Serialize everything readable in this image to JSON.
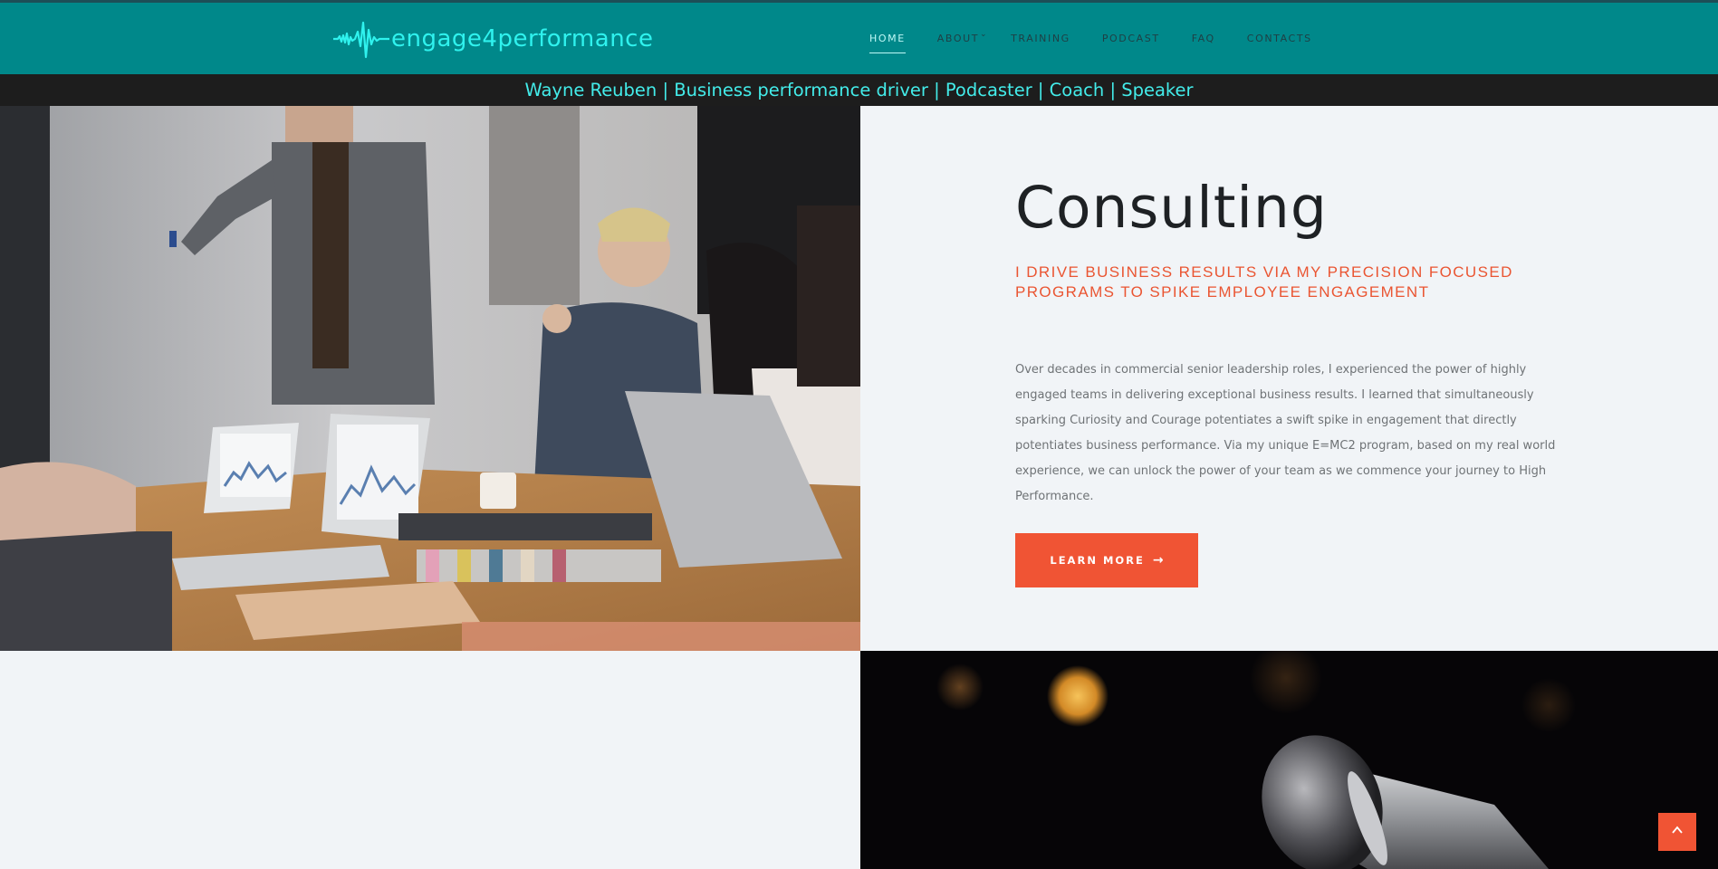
{
  "header": {
    "logo_text": "engage4performance",
    "logo_icon": "soundwave-icon"
  },
  "nav": {
    "items": [
      {
        "label": "HOME",
        "active": true
      },
      {
        "label": "ABOUT",
        "has_dropdown": true
      },
      {
        "label": "TRAINING"
      },
      {
        "label": "PODCAST"
      },
      {
        "label": "FAQ"
      },
      {
        "label": "CONTACTS"
      }
    ]
  },
  "tagline": "Wayne Reuben | Business performance driver | Podcaster | Coach | Speaker",
  "consulting": {
    "title": "Consulting",
    "subtitle": "I DRIVE BUSINESS RESULTS VIA MY PRECISION FOCUSED PROGRAMS TO SPIKE EMPLOYEE ENGAGEMENT",
    "body": "Over decades in commercial senior leadership roles, I experienced the power of highly engaged teams in delivering exceptional business results. I learned that simultaneously sparking Curiosity and Courage potentiates a swift spike in engagement that directly potentiates business performance. Via my unique E=MC2 program, based on my real world experience, we can unlock the power of your team as we commence your journey to High Performance.",
    "button_label": "LEARN MORE",
    "button_icon": "arrow-right-icon"
  },
  "images": {
    "meeting": "meeting-photo",
    "microphone": "microphone-photo"
  },
  "colors": {
    "header_bg": "#00888a",
    "tagline_bg": "#1d1d1d",
    "tagline_text": "#43ecea",
    "accent": "#f05434",
    "subtitle": "#ea5532",
    "panel_bg": "#f1f4f7"
  },
  "back_to_top_icon": "chevron-up-icon"
}
